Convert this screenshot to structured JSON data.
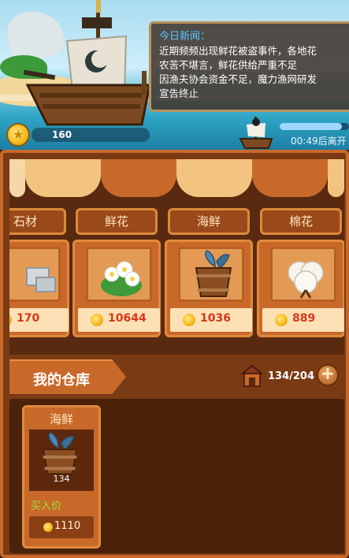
{
  "header": {
    "coins": "160",
    "voyage_progress": 0.9,
    "voyage_timer": "00:49后离开"
  },
  "news": {
    "title": "今日新闻：",
    "lines": [
      "近期频频出现鲜花被盗事件，各地花",
      "农苦不堪言，鲜花供给严重不足",
      "因渔夫协会资金不足，魔力渔网研发",
      "宣告终止"
    ]
  },
  "market": {
    "stalls": [
      {
        "label": "石材",
        "price": "170",
        "icon": "stone-icon"
      },
      {
        "label": "鲜花",
        "price": "10644",
        "icon": "flower-icon"
      },
      {
        "label": "海鲜",
        "price": "1036",
        "icon": "seafood-bucket-icon"
      },
      {
        "label": "棉花",
        "price": "889",
        "icon": "cotton-icon"
      }
    ]
  },
  "warehouse": {
    "title": "我的仓库",
    "capacity": "134/204",
    "add_label": "+",
    "items": [
      {
        "name": "海鲜",
        "count": "134",
        "buy_label": "买入价",
        "price": "1110",
        "icon": "seafood-bucket-icon"
      }
    ]
  },
  "colors": {
    "price_red": "#d8361a",
    "buy_green": "#9be03a",
    "news_title_blue": "#57c5ff"
  }
}
